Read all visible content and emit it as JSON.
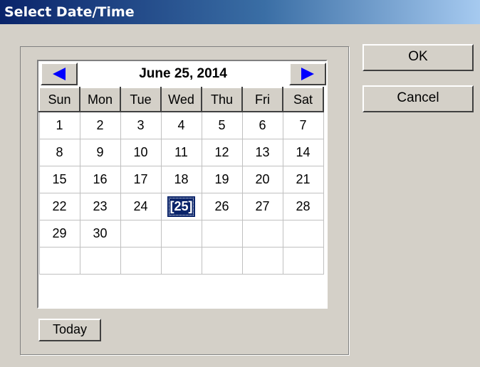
{
  "window": {
    "title": "Select Date/Time"
  },
  "calendar": {
    "month_title": "June 25, 2014",
    "weekdays": [
      "Sun",
      "Mon",
      "Tue",
      "Wed",
      "Thu",
      "Fri",
      "Sat"
    ],
    "weeks": [
      [
        "1",
        "2",
        "3",
        "4",
        "5",
        "6",
        "7"
      ],
      [
        "8",
        "9",
        "10",
        "11",
        "12",
        "13",
        "14"
      ],
      [
        "15",
        "16",
        "17",
        "18",
        "19",
        "20",
        "21"
      ],
      [
        "22",
        "23",
        "24",
        "[25]",
        "26",
        "27",
        "28"
      ],
      [
        "29",
        "30",
        "",
        "",
        "",
        "",
        ""
      ],
      [
        "",
        "",
        "",
        "",
        "",
        "",
        ""
      ]
    ],
    "selected_day": "[25]",
    "prev_icon": "left-arrow-icon",
    "next_icon": "right-arrow-icon",
    "arrow_color": "#0000ff",
    "selection_color": "#0a246a"
  },
  "buttons": {
    "today": "Today",
    "ok": "OK",
    "cancel": "Cancel"
  }
}
